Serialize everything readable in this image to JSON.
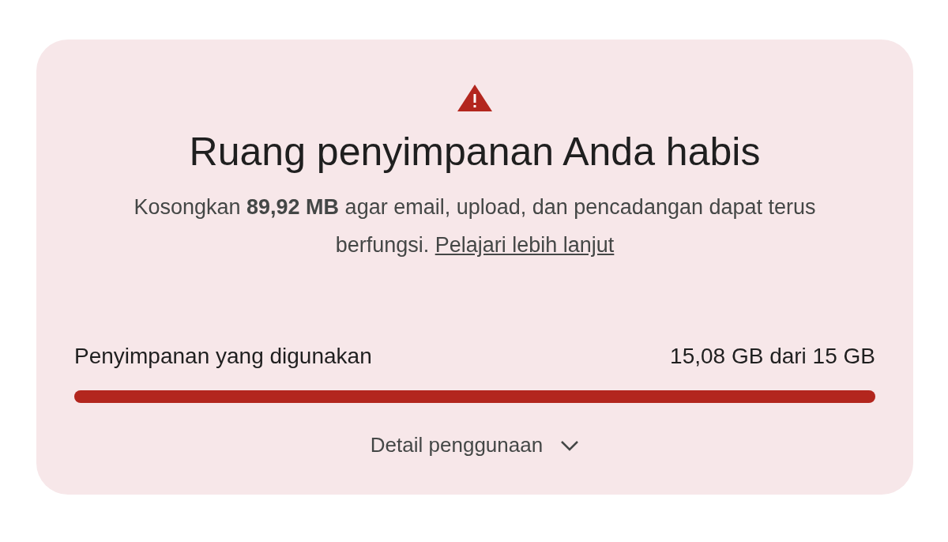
{
  "alert": {
    "title": "Ruang penyimpanan Anda habis",
    "message": "Kosongkan **89,92 MB** agar email, upload, dan pencadangan dapat terus berfungsi.",
    "link": "Pelajari lebih lanjut"
  },
  "storage": {
    "label": "Penyimpanan yang digunakan",
    "reading": "15,08 GB dari 15 GB",
    "level": 1
  },
  "details": {
    "label": "Detail penggunaan",
    "expanded": false
  }
}
